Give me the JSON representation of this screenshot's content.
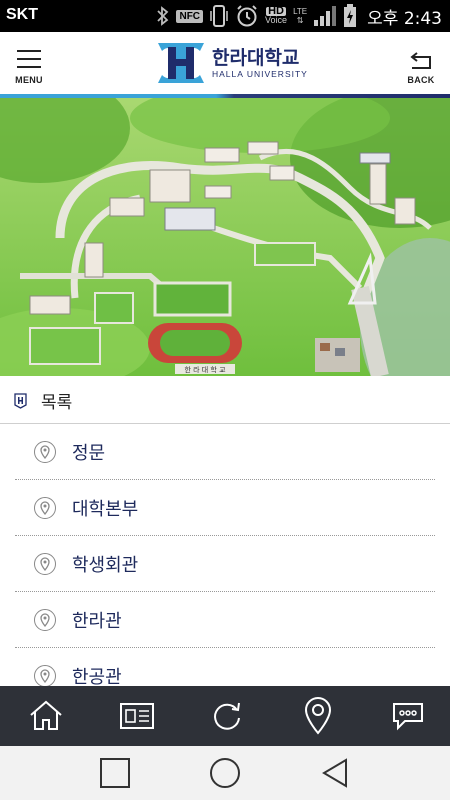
{
  "status_bar": {
    "carrier": "SKT",
    "nfc": "NFC",
    "hd": "HD",
    "voice": "Voice",
    "lte": "LTE",
    "time": "오후 2:43",
    "icons": [
      "bluetooth-icon",
      "nfc-icon",
      "vibrate-icon",
      "alarm-icon",
      "hd-voice-icon",
      "lte-icon",
      "signal-icon",
      "battery-icon"
    ]
  },
  "header": {
    "menu_label": "MENU",
    "back_label": "BACK",
    "logo_kr": "한라대학교",
    "logo_en": "HALLA UNIVERSITY",
    "accent_color": "#3aa3d8",
    "brand_color": "#1f2c6b"
  },
  "map": {
    "sign_text": "한 라 대 학 교"
  },
  "list": {
    "title": "목록",
    "items": [
      {
        "label": "정문"
      },
      {
        "label": "대학본부"
      },
      {
        "label": "학생회관"
      },
      {
        "label": "한라관"
      },
      {
        "label": "한공관"
      }
    ]
  },
  "tab_bar": {
    "tabs": [
      "home-icon",
      "directory-icon",
      "refresh-icon",
      "location-pin-icon",
      "chat-icon"
    ],
    "background": "#2e3138"
  },
  "nav_bar": {
    "buttons": [
      "recent-apps-icon",
      "home-icon",
      "back-icon"
    ]
  }
}
